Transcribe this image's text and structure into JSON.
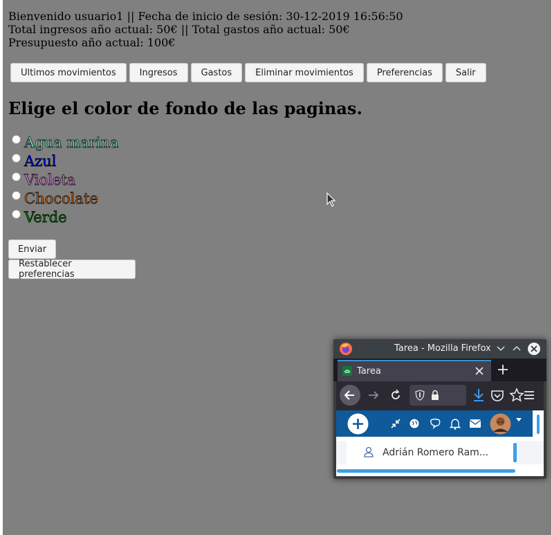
{
  "info": {
    "line1": "Bienvenido usuario1 || Fecha de inicio de sesión: 30-12-2019 16:56:50",
    "line2": "Total ingresos año actual: 50€ || Total gastos año actual: 50€",
    "line3": "Presupuesto año actual: 100€"
  },
  "nav": [
    {
      "label": "Ultimos movimientos"
    },
    {
      "label": "Ingresos"
    },
    {
      "label": "Gastos"
    },
    {
      "label": "Eliminar movimientos"
    },
    {
      "label": "Preferencias"
    },
    {
      "label": "Salir"
    }
  ],
  "heading": "Elige el color de fondo de las paginas.",
  "options": [
    {
      "label": "Agua marina",
      "color": "#7fffd4"
    },
    {
      "label": "Azul",
      "color": "#0000ff"
    },
    {
      "label": "Violeta",
      "color": "#ee82ee"
    },
    {
      "label": "Chocolate",
      "color": "#d2691e"
    },
    {
      "label": "Verde",
      "color": "#008000"
    }
  ],
  "buttons": {
    "enviar": "Enviar",
    "reset": "Restablecer preferencias"
  },
  "firefox": {
    "window_title": "Tarea - Mozilla Firefox",
    "tab_title": "Tarea",
    "user_name": "Adrián Romero Ram..."
  },
  "colors": {
    "page_bg": "#808080",
    "firefox_accent": "#0e5a9a"
  }
}
